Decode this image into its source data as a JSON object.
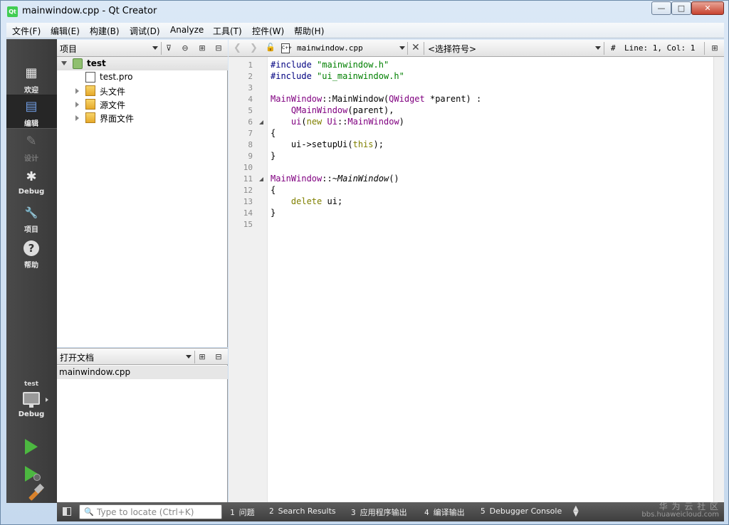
{
  "window": {
    "title": "mainwindow.cpp - Qt Creator",
    "app_icon": "Qt",
    "minimize": "—",
    "maximize": "□",
    "close": "✕"
  },
  "menu": [
    "文件(F)",
    "编辑(E)",
    "构建(B)",
    "调试(D)",
    "Analyze",
    "工具(T)",
    "控件(W)",
    "帮助(H)"
  ],
  "modes": [
    {
      "label": "欢迎",
      "icon": "▦"
    },
    {
      "label": "编辑",
      "icon": "▤"
    },
    {
      "label": "设计",
      "icon": "✎"
    },
    {
      "label": "Debug",
      "icon": "✱"
    },
    {
      "label": "项目",
      "icon": "🔧"
    },
    {
      "label": "帮助",
      "icon": "?"
    }
  ],
  "target": {
    "project": "test",
    "config": "Debug"
  },
  "projects_pane": {
    "title": "项目",
    "tree": [
      {
        "label": "test",
        "kind": "project",
        "expanded": true,
        "depth": 0
      },
      {
        "label": "test.pro",
        "kind": "file",
        "depth": 1
      },
      {
        "label": "头文件",
        "kind": "folder",
        "expanded": false,
        "depth": 1
      },
      {
        "label": "源文件",
        "kind": "folder",
        "expanded": false,
        "depth": 1
      },
      {
        "label": "界面文件",
        "kind": "folder",
        "expanded": false,
        "depth": 1
      }
    ]
  },
  "open_docs_pane": {
    "title": "打开文档",
    "items": [
      "mainwindow.cpp"
    ]
  },
  "editor_toolbar": {
    "file_icon": "C++",
    "file": "mainwindow.cpp",
    "symbol": "<选择符号>",
    "hash": "#",
    "position": "Line: 1, Col: 1"
  },
  "code_lines": [
    "1",
    "2",
    "3",
    "4",
    "5",
    "6",
    "7",
    "8",
    "9",
    "10",
    "11",
    "12",
    "13",
    "14",
    "15"
  ],
  "code": {
    "l1a": "#include ",
    "l1b": "\"mainwindow.h\"",
    "l2a": "#include ",
    "l2b": "\"ui_mainwindow.h\"",
    "l4a": "MainWindow",
    "l4b": "::MainWindow(",
    "l4c": "QWidget",
    "l4d": " *parent) :",
    "l5a": "    ",
    "l5b": "QMainWindow",
    "l5c": "(parent),",
    "l6a": "    ",
    "l6b": "ui",
    "l6c": "(",
    "l6d": "new",
    "l6e": " ",
    "l6f": "Ui",
    "l6g": "::",
    "l6h": "MainWindow",
    "l6i": ")",
    "l7": "{",
    "l8a": "    ",
    "l8b": "ui",
    "l8c": "->setupUi(",
    "l8d": "this",
    "l8e": ");",
    "l9": "}",
    "l11a": "MainWindow",
    "l11b": "::~",
    "l11c": "MainWindow",
    "l11d": "()",
    "l12": "{",
    "l13a": "    ",
    "l13b": "delete",
    "l13c": " ",
    "l13d": "ui",
    "l13e": ";",
    "l14": "}"
  },
  "statusbar": {
    "locator_placeholder": "Type to locate (Ctrl+K)",
    "locator_icon": "🔍",
    "panes": [
      {
        "num": "1",
        "label": "问题"
      },
      {
        "num": "2",
        "label": "Search Results"
      },
      {
        "num": "3",
        "label": "应用程序输出"
      },
      {
        "num": "4",
        "label": "编译输出"
      },
      {
        "num": "5",
        "label": "Debugger Console"
      }
    ],
    "watermark_line1": "华 为 云 社 区",
    "watermark_line2": "bbs.huaweicloud.com"
  },
  "colors": {
    "preprocessor": "#000080",
    "string": "#008000",
    "type": "#800080",
    "keyword": "#808000"
  }
}
